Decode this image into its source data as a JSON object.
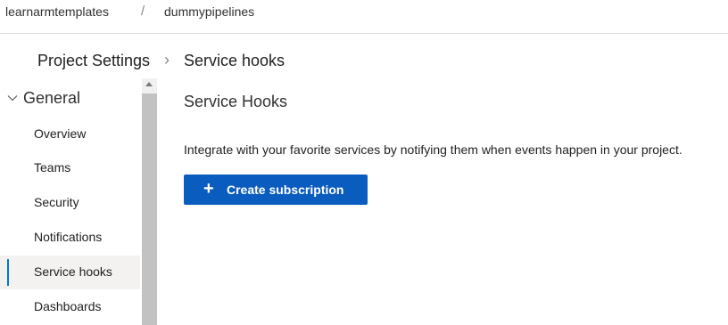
{
  "breadcrumb": {
    "organization": "learnarmtemplates",
    "separator": "/",
    "project": "dummypipelines"
  },
  "header": {
    "settings_title": "Project Settings",
    "chevron": "›",
    "page_title": "Service hooks"
  },
  "sidebar": {
    "group_label": "General",
    "group_icon": "chevron-down-icon",
    "items": [
      {
        "label": "Overview",
        "active": false
      },
      {
        "label": "Teams",
        "active": false
      },
      {
        "label": "Security",
        "active": false
      },
      {
        "label": "Notifications",
        "active": false
      },
      {
        "label": "Service hooks",
        "active": true
      },
      {
        "label": "Dashboards",
        "active": false
      }
    ]
  },
  "main": {
    "section_title": "Service Hooks",
    "description": "Integrate with your favorite services by notifying them when events happen in your project.",
    "create_button": {
      "label": "Create subscription",
      "icon": "plus-icon",
      "plus": "+"
    }
  },
  "colors": {
    "accent": "#0078d4",
    "button_bg": "#0b5cbf",
    "active_item_bg": "#f3f2f1"
  }
}
